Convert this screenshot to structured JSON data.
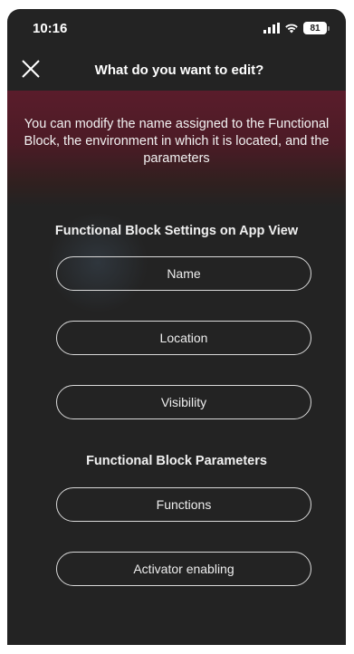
{
  "status_bar": {
    "time": "10:16",
    "battery": "81",
    "icons": [
      "cellular-signal-icon",
      "wifi-icon",
      "battery-icon"
    ]
  },
  "header": {
    "title": "What do you want to edit?",
    "close_icon": "close-icon"
  },
  "banner": {
    "text": "You can modify the name assigned to the Functional Block, the environment in which it is located, and the parameters"
  },
  "app_view_section": {
    "title": "Functional Block Settings on App View",
    "buttons": [
      "Name",
      "Location",
      "Visibility"
    ]
  },
  "parameters_section": {
    "title": "Functional Block Parameters",
    "buttons": [
      "Functions",
      "Activator enabling"
    ]
  },
  "colors": {
    "background": "#232323",
    "banner": "#5a1c2b",
    "pill_border": "#d9d9d9",
    "text": "#ffffff"
  }
}
